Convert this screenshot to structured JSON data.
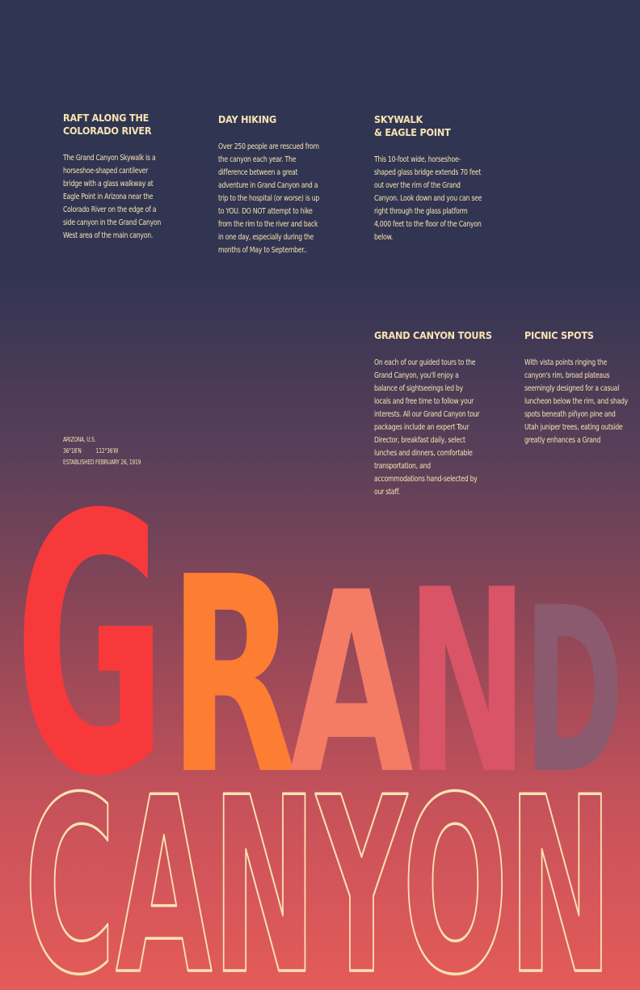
{
  "sections": [
    {
      "heading": "Raft along the\nColorado River",
      "body": "The Grand Canyon Skywalk is a horseshoe-shaped cantilever bridge with a glass walkway at Eagle Point in Arizona near the Colorado River on the edge of a side canyon in the Grand Canyon West area of the main canyon."
    },
    {
      "heading": "Day Hiking",
      "body": "Over 250 people are rescued from the canyon each year. The difference between a great adventure in Grand Canyon and a trip to the hospital (or worse) is up to YOU. DO NOT attempt to hike from the rim to the river and back in one day, especially during the months of May to September.."
    },
    {
      "heading": "Skywalk\n& Eagle Point",
      "body": "This 10-foot wide, horseshoe-shaped glass bridge extends 70 feet out over the rim of the Grand Canyon. Look down and you can see right through the glass platform 4,000 feet to the floor of the Canyon below."
    },
    {
      "heading": "Grand Canyon Tours",
      "body": "On each of our guided tours to the Grand Canyon, you'll enjoy a balance of sightseeings led by locals and free time to follow your interests. All our Grand Canyon tour packages include an expert Tour Director, breakfast daily, select lunches and dinners, comfortable transportation, and accommodations hand-selected by our staff."
    },
    {
      "heading": "Picnic Spots",
      "body": "With vista points ringing the canyon's rim, broad plateaus seemingly designed for a casual luncheon below the rim, and shady spots beneath piñyon pine and Utah juniper trees, eating outside greatly enhances a Grand"
    }
  ],
  "meta": {
    "location": "ARIZONA, U.S.",
    "latitude": "36°18′N",
    "longitude": "112°36′W",
    "established": "ESTABLISHED FEBRUARY 26, 1919"
  },
  "title": {
    "word1_letters": [
      {
        "char": "G",
        "color": "#f7393b"
      },
      {
        "char": "R",
        "color": "#fd7d33"
      },
      {
        "char": "A",
        "color": "#f47c65"
      },
      {
        "char": "N",
        "color": "#d95466"
      },
      {
        "char": "D",
        "color": "#8c5a6e"
      }
    ],
    "word2": "CANYON",
    "outline_color": "#f7e3b2"
  }
}
